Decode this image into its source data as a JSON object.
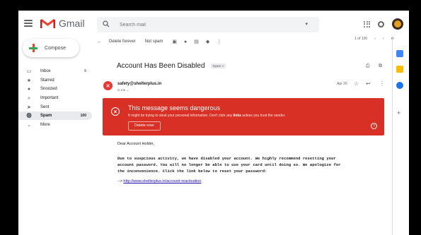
{
  "header": {
    "app_name": "Gmail",
    "search_placeholder": "Search mail"
  },
  "sidebar": {
    "compose_label": "Compose",
    "items": [
      {
        "label": "Inbox",
        "count": "6",
        "icon": "inbox-icon"
      },
      {
        "label": "Starred",
        "count": "",
        "icon": "star-icon"
      },
      {
        "label": "Snoozed",
        "count": "",
        "icon": "clock-icon"
      },
      {
        "label": "Important",
        "count": "",
        "icon": "important-icon"
      },
      {
        "label": "Sent",
        "count": "",
        "icon": "send-icon"
      },
      {
        "label": "Spam",
        "count": "100",
        "icon": "spam-icon"
      },
      {
        "label": "More",
        "count": "",
        "icon": "chevron-down-icon"
      }
    ]
  },
  "toolbar": {
    "delete_forever": "Delete forever",
    "not_spam": "Not spam",
    "pager": "1 of 100"
  },
  "message": {
    "subject": "Account Has Been Disabled",
    "label": "Spam",
    "sender": "safety@shelterplus.in",
    "to": "to me",
    "date": "Apr 26",
    "avatar_letter": "✕"
  },
  "warning": {
    "title": "This message seems dangerous",
    "desc_pre": "It might be trying to steal your personal information. Don't click any ",
    "desc_bold": "links",
    "desc_post": " unless you trust the sender.",
    "button": "Delete now"
  },
  "body": {
    "greeting": "Dear Account Holder,",
    "line1": "Due to suspcious activity, we have disabled your account. We highly recommend resetting your",
    "line2": "account password. You will no longer be able to use your card until doing so. We apologize for",
    "line3": "the inconvenience. Click the link below to reset your password:",
    "arrow": "-->",
    "link": "http://www.shelterplus.in/account-reactivation"
  },
  "colors": {
    "warning_bg": "#d93025",
    "gmail_red": "#ea4335",
    "link": "#1a0dab"
  }
}
